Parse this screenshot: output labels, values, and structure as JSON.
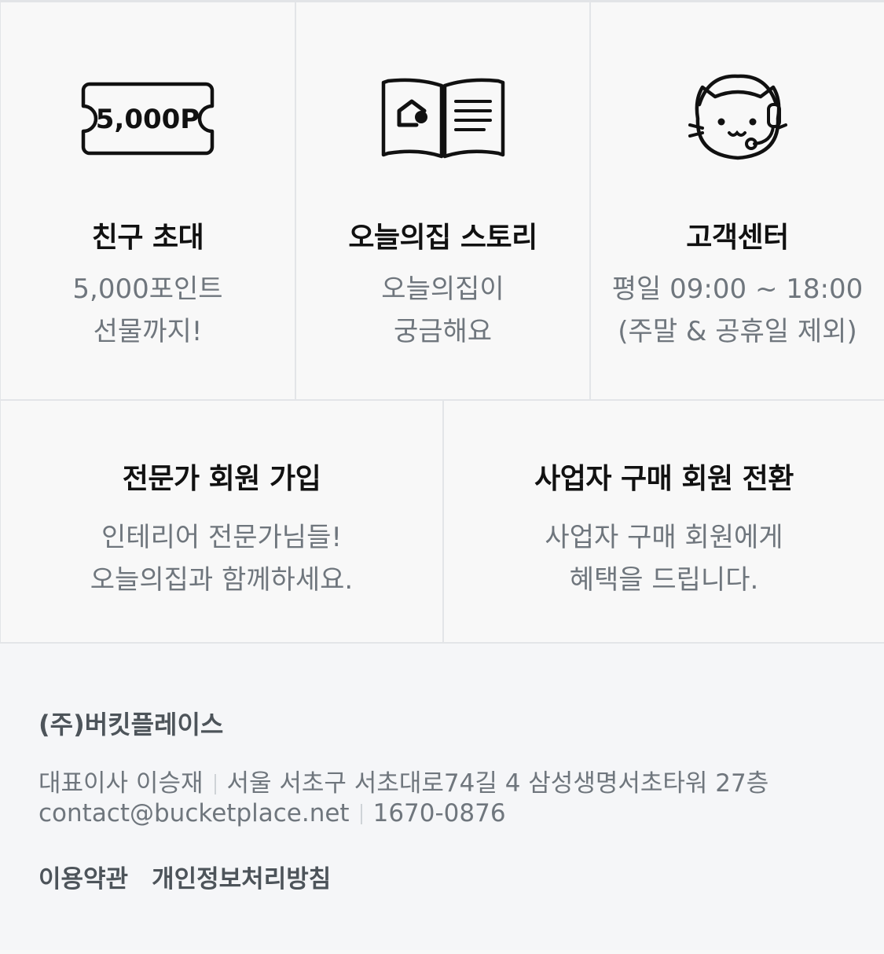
{
  "cards_top": [
    {
      "icon": "coupon-5000p-icon",
      "icon_text": "5,000P",
      "title": "친구 초대",
      "desc": [
        "5,000포인트",
        "선물까지!"
      ]
    },
    {
      "icon": "open-book-house-icon",
      "title": "오늘의집 스토리",
      "desc": [
        "오늘의집이",
        "궁금해요"
      ]
    },
    {
      "icon": "cat-headset-icon",
      "title": "고객센터",
      "desc": [
        "평일 09:00 ~ 18:00",
        "(주말 & 공휴일 제외)"
      ]
    }
  ],
  "cards_mid": [
    {
      "title": "전문가 회원 가입",
      "desc": [
        "인테리어 전문가님들!",
        "오늘의집과 함께하세요."
      ]
    },
    {
      "title": "사업자 구매 회원 전환",
      "desc": [
        "사업자 구매 회원에게",
        "혜택을 드립니다."
      ]
    }
  ],
  "footer": {
    "company": "(주)버킷플레이스",
    "ceo": "대표이사 이승재",
    "address": "서울 서초구 서초대로74길 4 삼성생명서초타워 27층",
    "email": "contact@bucketplace.net",
    "phone": "1670-0876",
    "links": [
      "이용약관",
      "개인정보처리방침"
    ]
  }
}
